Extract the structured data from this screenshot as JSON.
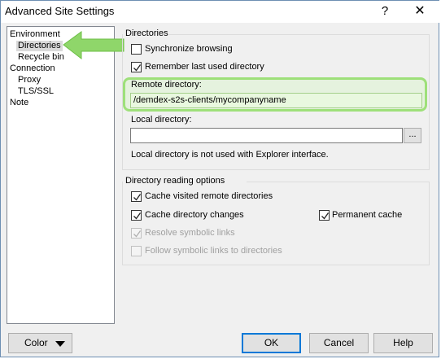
{
  "window": {
    "title": "Advanced Site Settings",
    "help_glyph": "?",
    "close_glyph": "✕"
  },
  "tree": {
    "items": [
      {
        "label": "Environment",
        "level": 0
      },
      {
        "label": "Directories",
        "level": 1,
        "selected": true
      },
      {
        "label": "Recycle bin",
        "level": 1
      },
      {
        "label": "Connection",
        "level": 0
      },
      {
        "label": "Proxy",
        "level": 1
      },
      {
        "label": "TLS/SSL",
        "level": 1
      },
      {
        "label": "Note",
        "level": 0
      }
    ]
  },
  "directories": {
    "group_title": "Directories",
    "sync_browsing": {
      "label": "Synchronize browsing",
      "checked": false
    },
    "remember_last": {
      "label": "Remember last used directory",
      "checked": true
    },
    "remote": {
      "label": "Remote directory:",
      "value": "/demdex-s2s-clients/mycompanyname"
    },
    "local": {
      "label": "Local directory:",
      "value": "",
      "browse_label": "..."
    },
    "local_note": "Local directory is not used with Explorer interface."
  },
  "reading": {
    "group_title": "Directory reading options",
    "cache_visited": {
      "label": "Cache visited remote directories",
      "checked": true
    },
    "cache_changes": {
      "label": "Cache directory changes",
      "checked": true
    },
    "permanent_cache": {
      "label": "Permanent cache",
      "checked": true
    },
    "resolve_symlinks": {
      "label": "Resolve symbolic links",
      "checked": true,
      "disabled": true
    },
    "follow_symlinks": {
      "label": "Follow symbolic links to directories",
      "checked": false,
      "disabled": true
    }
  },
  "buttons": {
    "color": "Color",
    "ok": "OK",
    "cancel": "Cancel",
    "help": "Help"
  },
  "colors": {
    "highlight": "#9ee07a",
    "arrow": "#8fd66a",
    "accent": "#0078d7"
  }
}
